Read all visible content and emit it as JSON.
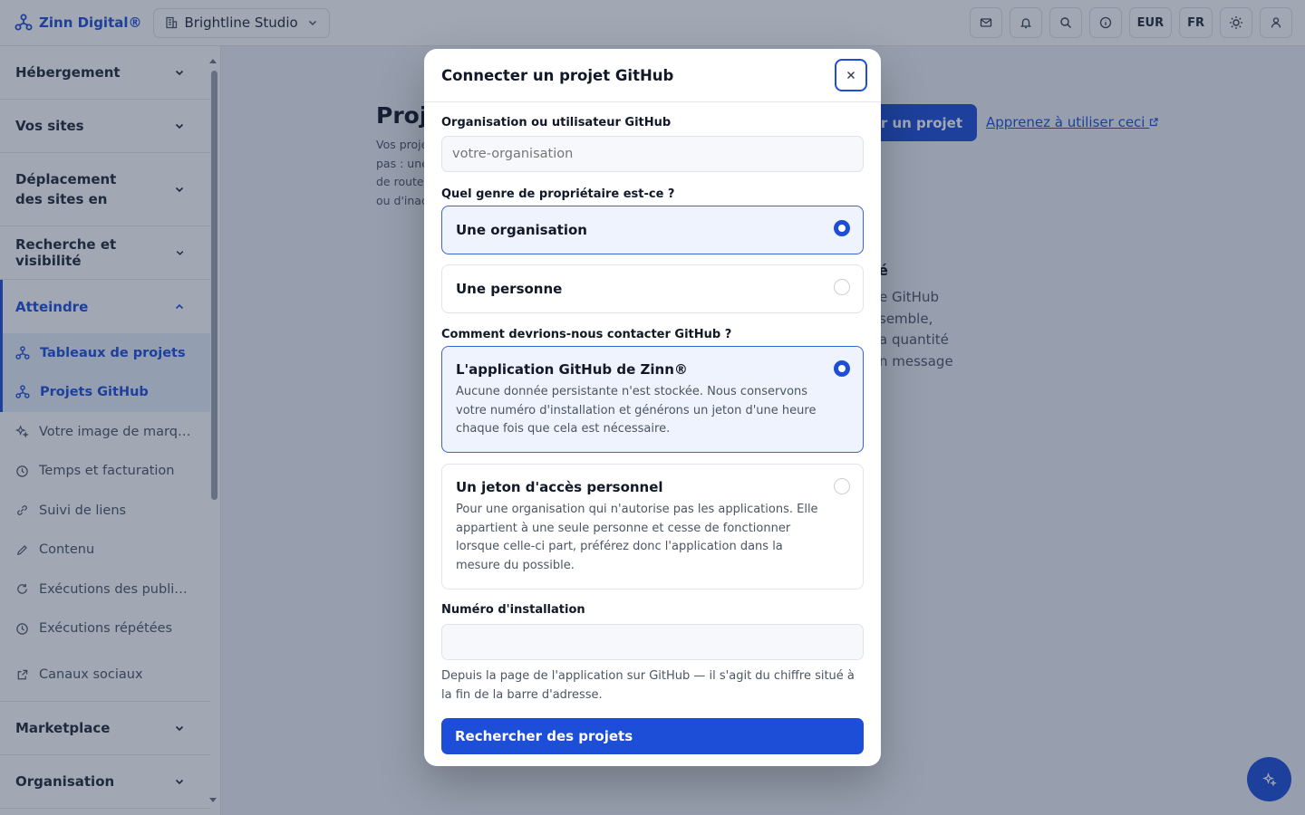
{
  "topbar": {
    "brand": "Zinn Digital®",
    "workspace": "Brightline Studio",
    "currency": "EUR",
    "language": "FR"
  },
  "sidebar": {
    "sections_top": [
      {
        "label": "Hébergement"
      },
      {
        "label": "Vos sites"
      },
      {
        "label": "Déplacement des sites en"
      },
      {
        "label": "Recherche et visibilité"
      }
    ],
    "active_section": "Atteindre",
    "items": [
      {
        "label": "Tableaux de projets",
        "icon": "projects-icon"
      },
      {
        "label": "Projets GitHub",
        "icon": "projects-icon"
      },
      {
        "label": "Votre image de marque",
        "icon": "sparkle-icon"
      },
      {
        "label": "Temps et facturation",
        "icon": "clock-icon"
      },
      {
        "label": "Suivi de liens",
        "icon": "link-icon"
      },
      {
        "label": "Contenu",
        "icon": "pencil-icon"
      },
      {
        "label": "Exécutions des publica...",
        "icon": "refresh-icon"
      },
      {
        "label": "Exécutions répétées",
        "icon": "clock-icon"
      },
      {
        "label": "Canaux sociaux",
        "icon": "external-link-icon"
      }
    ],
    "sections_bottom": [
      {
        "label": "Marketplace"
      },
      {
        "label": "Organisation"
      }
    ]
  },
  "main": {
    "title": "Proj",
    "description_lines": [
      "Vos proje",
      "pas : une",
      "de route",
      "ou d'inac"
    ],
    "create_button": "er un projet",
    "learn_link": "Apprenez à utiliser ceci",
    "empty_title": "é",
    "empty_lines": [
      "e GitHub",
      "semble,",
      "a quantité",
      "n message"
    ]
  },
  "modal": {
    "title": "Connecter un projet GitHub",
    "org_label": "Organisation ou utilisateur GitHub",
    "org_placeholder": "votre-organisation",
    "owner_question": "Quel genre de propriétaire est-ce ?",
    "owner_options": [
      {
        "label": "Une organisation",
        "selected": true
      },
      {
        "label": "Une personne",
        "selected": false
      }
    ],
    "contact_question": "Comment devrions-nous contacter GitHub ?",
    "contact_options": [
      {
        "label": "L'application GitHub de Zinn®",
        "desc": "Aucune donnée persistante n'est stockée. Nous conservons votre numéro d'installation et générons un jeton d'une heure chaque fois que cela est nécessaire.",
        "selected": true
      },
      {
        "label": "Un jeton d'accès personnel",
        "desc": "Pour une organisation qui n'autorise pas les applications. Elle appartient à une seule personne et cesse de fonctionner lorsque celle-ci part, préférez donc l'application dans la mesure du possible.",
        "selected": false
      }
    ],
    "install_label": "Numéro d'installation",
    "install_value": "",
    "install_hint": "Depuis la page de l'application sur GitHub — il s'agit du chiffre situé à la fin de la barre d'adresse.",
    "submit": "Rechercher des projets"
  },
  "colors": {
    "accent": "#1d4ed8",
    "overlay": "rgba(30,45,75,0.42)"
  }
}
